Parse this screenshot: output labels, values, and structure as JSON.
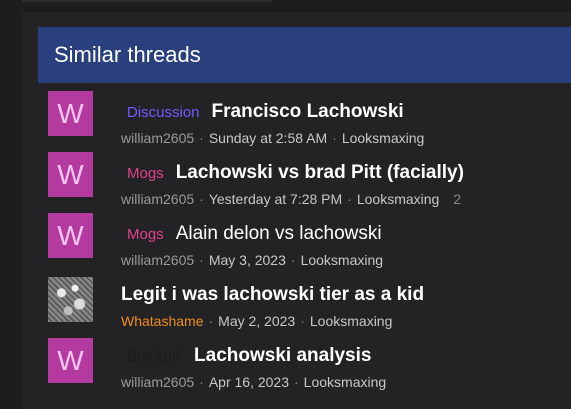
{
  "block": {
    "title": "Similar threads"
  },
  "threads": [
    {
      "avatar_letter": "W",
      "avatar_color": "#b53aa0",
      "label": "Discussion",
      "label_color": "#6f5bff",
      "title": "Francisco Lachowski",
      "author": "william2605",
      "author_color": "#9a9a9a",
      "date": "Sunday at 2:58 AM",
      "forum": "Looksmaxing",
      "replies": ""
    },
    {
      "avatar_letter": "W",
      "avatar_color": "#b53aa0",
      "label": "Mogs",
      "label_color": "#e0418b",
      "title": "Lachowski vs brad Pitt (facially)",
      "author": "william2605",
      "author_color": "#9a9a9a",
      "date": "Yesterday at 7:28 PM",
      "forum": "Looksmaxing",
      "replies": "2"
    },
    {
      "avatar_letter": "W",
      "avatar_color": "#b53aa0",
      "label": "Mogs",
      "label_color": "#e0418b",
      "title": "Alain delon vs lachowski",
      "author": "william2605",
      "author_color": "#9a9a9a",
      "date": "May 3, 2023",
      "forum": "Looksmaxing",
      "replies": ""
    },
    {
      "avatar_letter": "",
      "avatar_color": "#777777",
      "label": "",
      "label_color": "#ffffff",
      "title": "Legit i was lachowski tier as a kid",
      "author": "Whatashame",
      "author_color": "#f08c1e",
      "date": "May 2, 2023",
      "forum": "Looksmaxing",
      "replies": ""
    },
    {
      "avatar_letter": "W",
      "avatar_color": "#b53aa0",
      "label": "Blackpill",
      "label_color": "#1c1c1c",
      "title": "Lachowski analysis",
      "author": "william2605",
      "author_color": "#9a9a9a",
      "date": "Apr 16, 2023",
      "forum": "Looksmaxing",
      "replies": ""
    }
  ]
}
